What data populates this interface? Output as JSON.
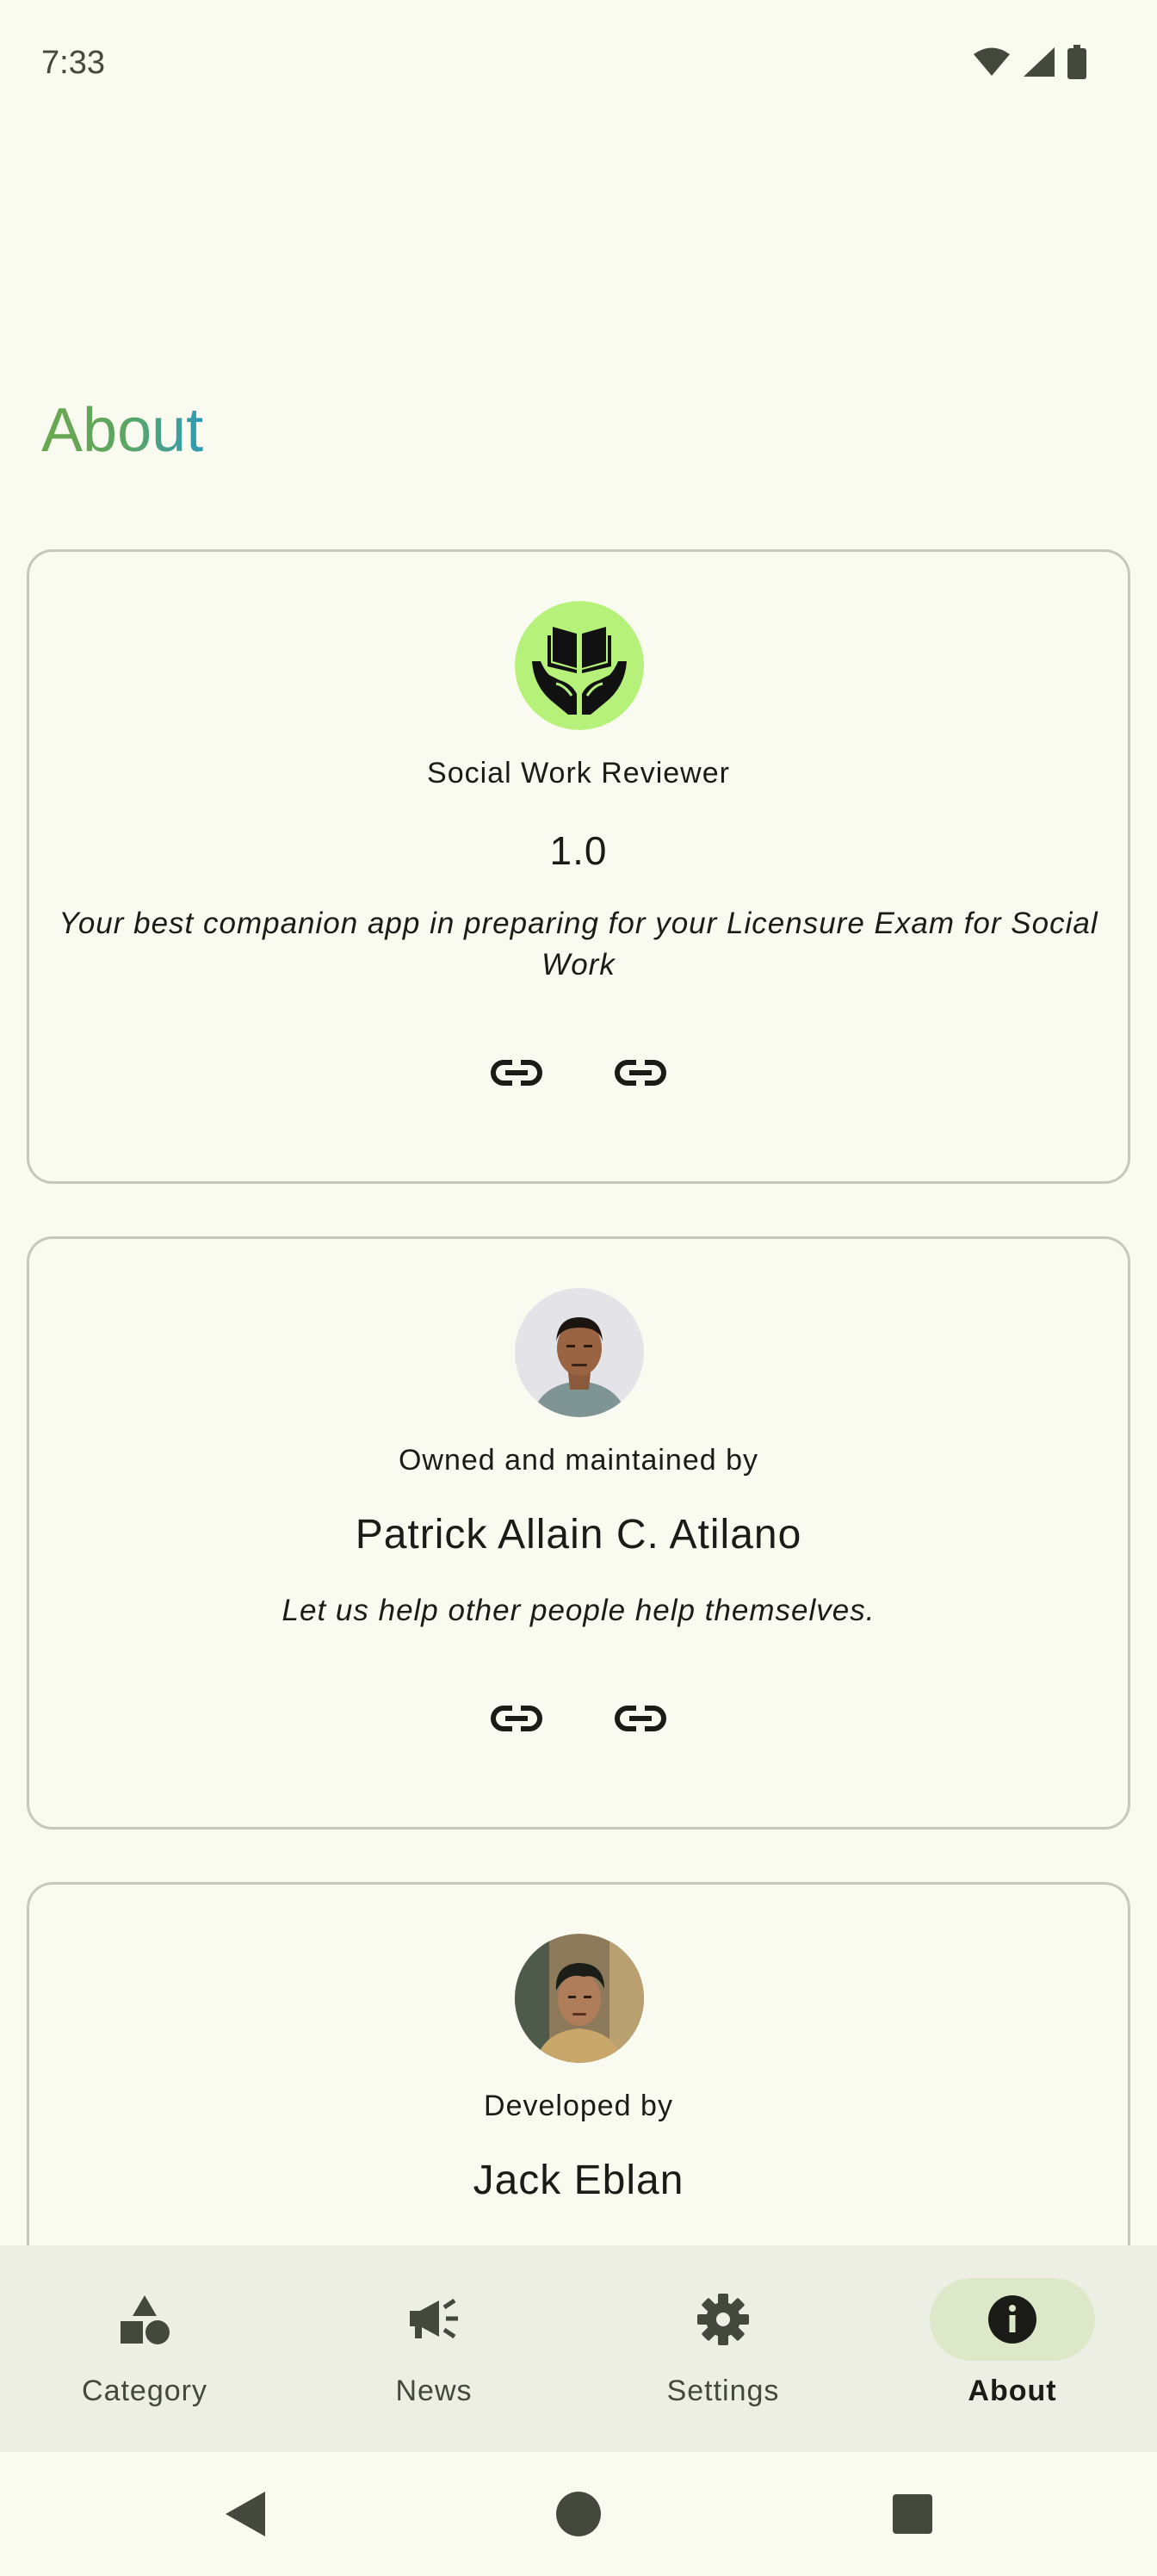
{
  "status_bar": {
    "time": "7:33",
    "icons": [
      "wifi-icon",
      "signal-icon",
      "battery-icon"
    ]
  },
  "page": {
    "title": "About"
  },
  "app_card": {
    "app_name": "Social Work Reviewer",
    "version": "1.0",
    "description": "Your best companion app in preparing for your Licensure Exam for Social Work",
    "icon": "book-hands-logo"
  },
  "owner_card": {
    "label": "Owned and maintained by",
    "name": "Patrick Allain C. Atilano",
    "quote": "Let us help other people help themselves."
  },
  "developer_card": {
    "label": "Developed by",
    "name": "Jack Eblan"
  },
  "bottom_nav": {
    "items": [
      {
        "label": "Category",
        "icon": "shapes-icon"
      },
      {
        "label": "News",
        "icon": "megaphone-icon"
      },
      {
        "label": "Settings",
        "icon": "gear-icon"
      },
      {
        "label": "About",
        "icon": "info-icon",
        "active": true
      }
    ]
  },
  "colors": {
    "background": "#f9fbf0",
    "nav_background": "#edefe4",
    "active_pill": "#dce8c8",
    "title_gradient_start": "#6aa84f",
    "title_gradient_end": "#2f9bb5",
    "logo_green": "#b6f27a"
  }
}
